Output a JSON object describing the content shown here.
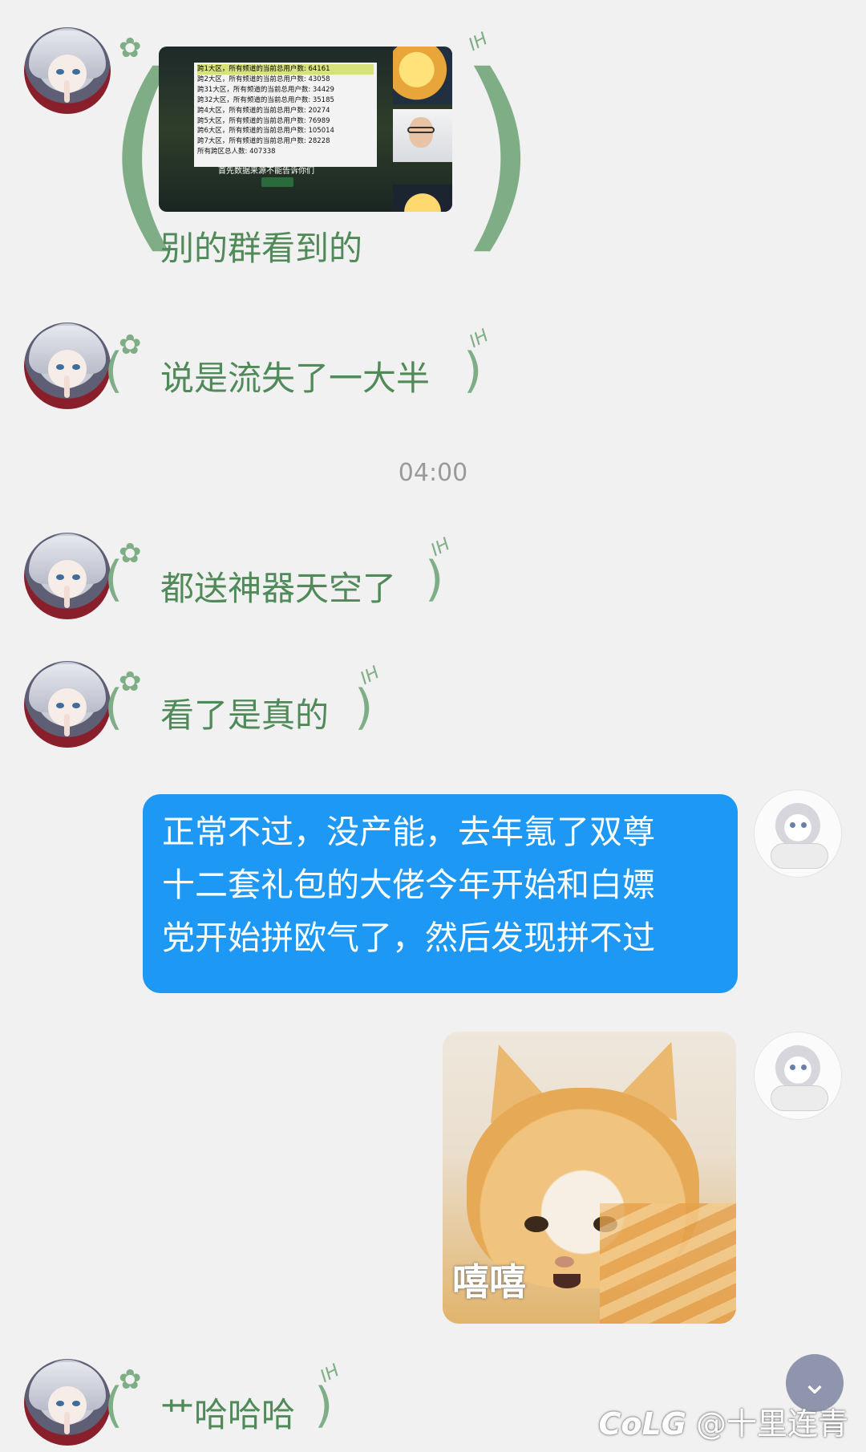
{
  "messages": [
    {
      "sender": "other",
      "type": "image_with_text",
      "text": "别的群看到的",
      "image": {
        "table_rows": [
          "跨1大区，所有频道的当前总用户数: 64161",
          "跨2大区，所有频道的当前总用户数: 43058",
          "跨31大区，所有频道的当前总用户数: 34429",
          "跨32大区，所有频道的当前总用户数: 35185",
          "跨4大区，所有频道的当前总用户数: 20274",
          "跨5大区，所有频道的当前总用户数: 76989",
          "跨6大区，所有频道的当前总用户数: 105014",
          "跨7大区，所有频道的当前总用户数: 28228",
          "所有跨区总人数: 407338"
        ],
        "caption": "首先数据来源不能告诉你们"
      }
    },
    {
      "sender": "other",
      "type": "text",
      "text": "说是流失了一大半"
    },
    {
      "sender": "other",
      "type": "text",
      "text": "都送神器天空了"
    },
    {
      "sender": "other",
      "type": "text",
      "text": "看了是真的"
    },
    {
      "sender": "self",
      "type": "text",
      "lines": [
        "正常不过，没产能，去年氪了双尊",
        "十二套礼包的大佬今年开始和白嫖",
        "党开始拼欧气了，然后发现拼不过"
      ]
    },
    {
      "sender": "self",
      "type": "sticker",
      "caption": "嘻嘻"
    },
    {
      "sender": "other",
      "type": "text",
      "text": "艹哈哈哈"
    }
  ],
  "timestamp": "04:00",
  "watermark": {
    "brand": "CoLG",
    "handle": "@十里连青"
  },
  "icons": {
    "scroll_down": "chevron-down-icon",
    "bubble_mark": "IH"
  },
  "colors": {
    "background": "#f1f1f1",
    "self_bubble": "#1e98f5",
    "other_text": "#4f8a58",
    "timestamp": "#9a9a9a"
  }
}
